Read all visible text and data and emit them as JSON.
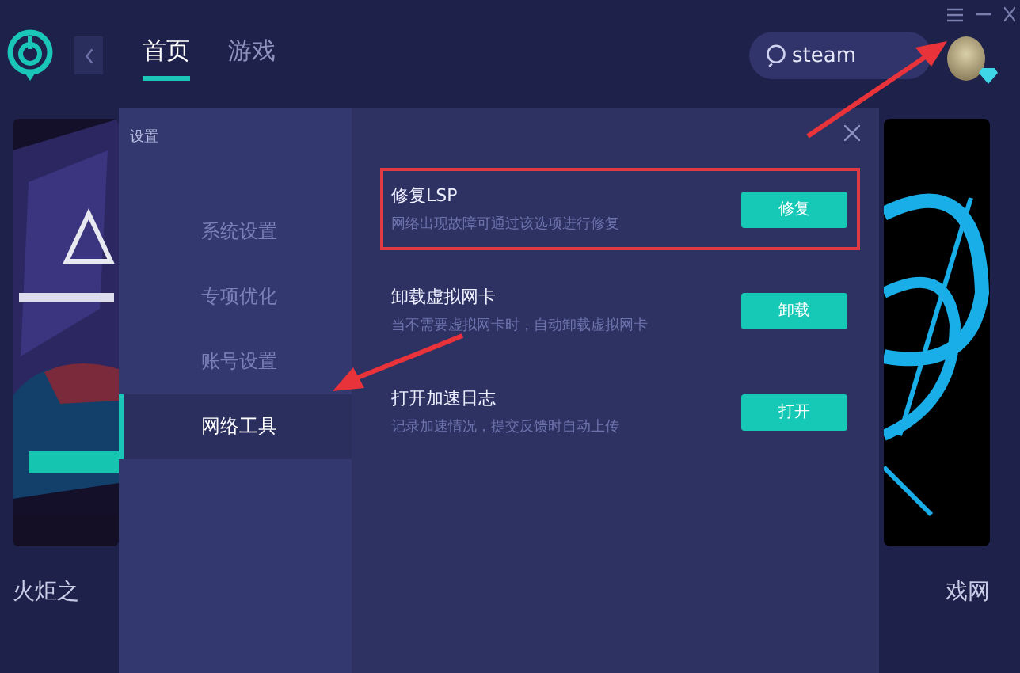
{
  "top_bar": {
    "tabs": [
      {
        "label": "首页",
        "selected": true
      },
      {
        "label": "游戏",
        "selected": false
      }
    ],
    "search": {
      "value": "steam"
    }
  },
  "cards": [
    {
      "kind": "picture",
      "caption": "火炬之"
    },
    {
      "kind": "picture",
      "caption": "戏网"
    }
  ],
  "settings_dialog": {
    "title": "设置",
    "nav": [
      {
        "label": "系统设置",
        "selected": false
      },
      {
        "label": "专项优化",
        "selected": false
      },
      {
        "label": "账号设置",
        "selected": false
      },
      {
        "label": "网络工具",
        "selected": true
      }
    ],
    "tools": [
      {
        "title": "修复LSP",
        "description": "网络出现故障可通过该选项进行修复",
        "button": "修复",
        "highlighted": true
      },
      {
        "title": "卸载虚拟网卡",
        "description": "当不需要虚拟网卡时，自动卸载虚拟网卡",
        "button": "卸载",
        "highlighted": false
      },
      {
        "title": "打开加速日志",
        "description": "记录加速情况，提交反馈时自动上传",
        "button": "打开",
        "highlighted": false
      }
    ]
  }
}
